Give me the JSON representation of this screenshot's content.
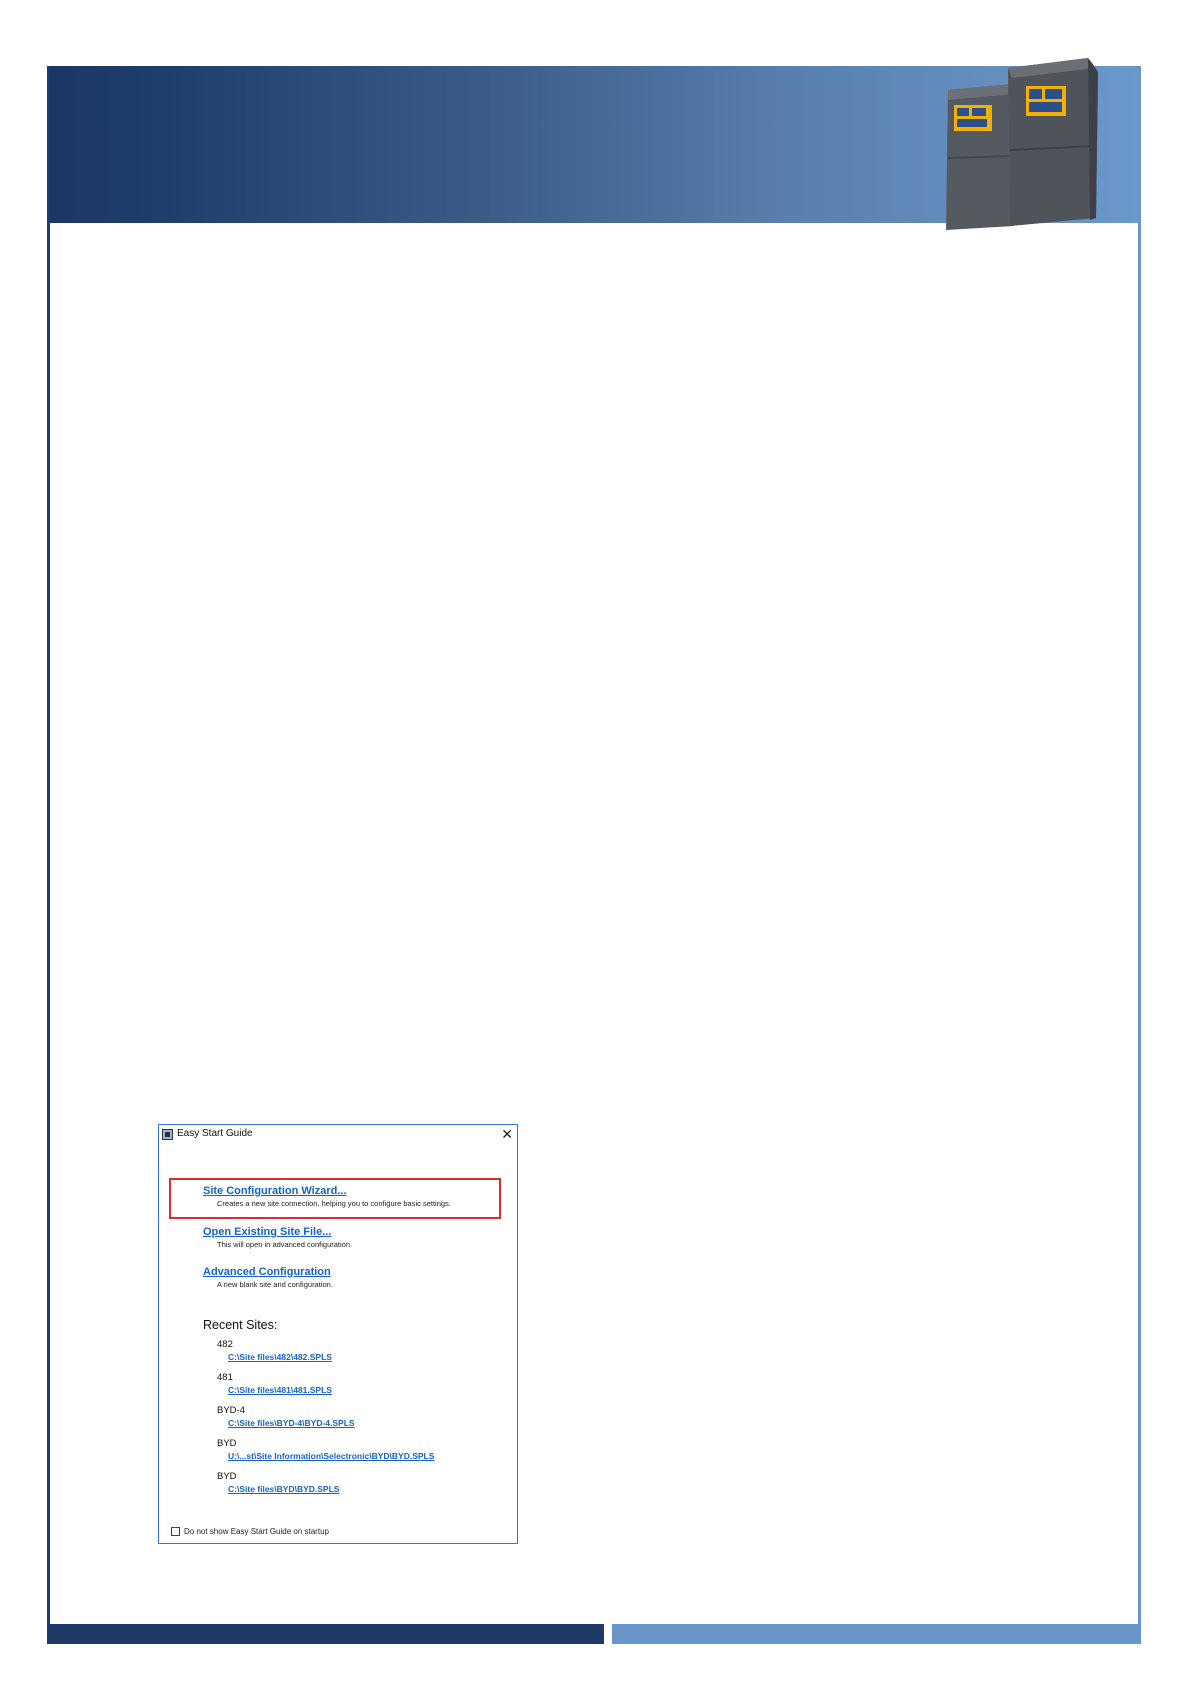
{
  "dialog": {
    "title": "Easy Start Guide",
    "close_glyph": "✕",
    "options": [
      {
        "label": "Site Configuration Wizard...",
        "description": "Creates a new site connection, helping you to configure basic settings."
      },
      {
        "label": "Open Existing Site File...",
        "description": "This will open in advanced configuration."
      },
      {
        "label": "Advanced Configuration",
        "description": "A new blank site and configuration."
      }
    ],
    "recent_heading": "Recent Sites:",
    "recent_sites": [
      {
        "name": "482",
        "path": "C:\\Site files\\482\\482.SPLS"
      },
      {
        "name": "481",
        "path": "C:\\Site files\\481\\481.SPLS"
      },
      {
        "name": "BYD-4",
        "path": "C:\\Site files\\BYD-4\\BYD-4.SPLS"
      },
      {
        "name": "BYD",
        "path": "U:\\...st\\Site Information\\Selectronic\\BYD\\BYD.SPLS"
      },
      {
        "name": "BYD",
        "path": "C:\\Site files\\BYD\\BYD.SPLS"
      }
    ],
    "startup_checkbox_label": "Do not show Easy Start Guide on startup",
    "startup_checked": false
  },
  "colors": {
    "banner_dark": "#1b3765",
    "banner_light": "#6b98cb",
    "link": "#1464c8",
    "highlight": "#d92e2e"
  }
}
